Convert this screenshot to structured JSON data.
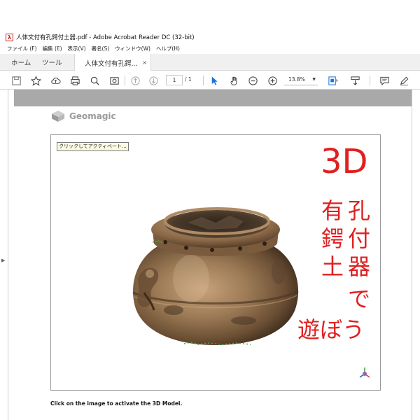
{
  "window": {
    "title": "人体文付有孔鍔付土器.pdf - Adobe Acrobat Reader DC (32-bit)",
    "app_icon": "acrobat-pdf-icon"
  },
  "menu": {
    "items": [
      "ファイル (F)",
      "編集 (E)",
      "表示(V)",
      "署名(S)",
      "ウィンドウ(W)",
      "ヘルプ(H)"
    ]
  },
  "tabs": {
    "home": "ホーム",
    "tools": "ツール",
    "document": "人体文付有孔鍔...",
    "close": "×"
  },
  "toolbar": {
    "icons": [
      "save-icon",
      "bookmark-star-icon",
      "upload-cloud-icon",
      "print-icon",
      "search-zoom-icon",
      "snapshot-icon",
      "prev-page-icon",
      "next-page-icon",
      "select-arrow-icon",
      "hand-tool-icon",
      "zoom-out-icon",
      "zoom-in-icon",
      "fit-page-icon",
      "scroll-mode-icon",
      "comment-icon",
      "pen-icon"
    ],
    "page_current": "1",
    "page_total": "/ 1",
    "zoom": "13.8%"
  },
  "document": {
    "logo_text": "Geomagic",
    "activate_button": "クリックしてアクティベート...",
    "headline_top": "3D",
    "headline_columns": [
      {
        "chars": [
          "孔",
          "付",
          "器"
        ]
      },
      {
        "chars": [
          "有",
          "鍔",
          "土"
        ]
      }
    ],
    "headline_lines": [
      "で",
      "遊ぼう"
    ],
    "caption": "Click on the image to activate the 3D Model."
  },
  "colors": {
    "headline": "#e02020",
    "band": "#a9a9a9",
    "pot_bronze": "#9b7a55"
  }
}
